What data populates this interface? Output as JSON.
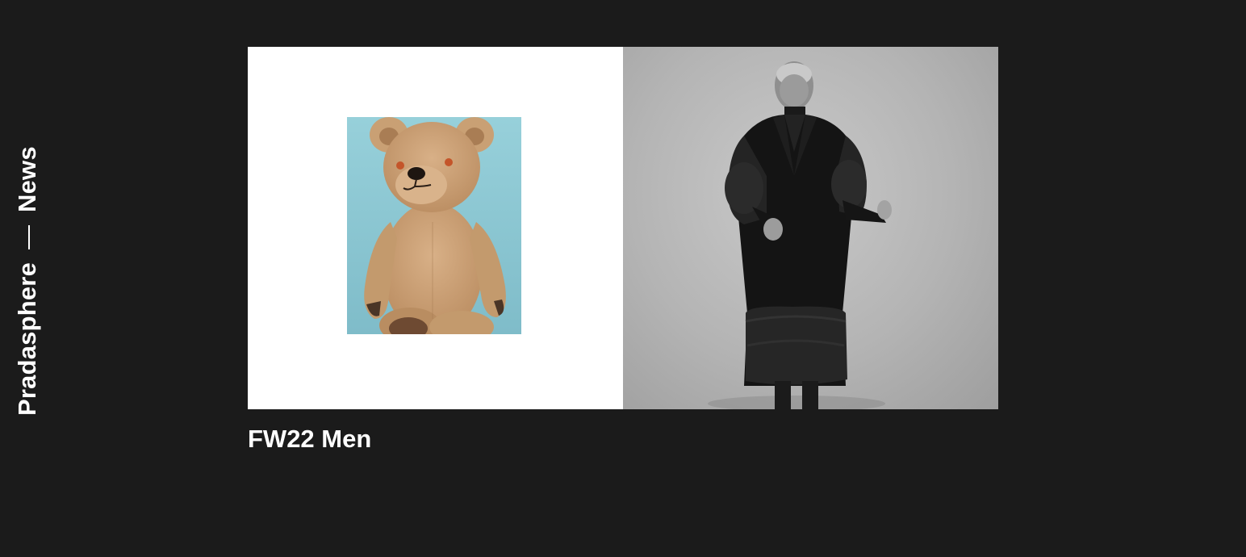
{
  "side_nav": {
    "section_label": "Pradasphere",
    "current_label": "News"
  },
  "card": {
    "title": "FW22 Men",
    "left_image": "teddy-bear-photo",
    "right_image": "man-in-fur-trim-coat-photo"
  },
  "colors": {
    "background": "#1b1b1b",
    "text": "#ffffff",
    "teddy_backdrop": "#8ec9d4"
  }
}
